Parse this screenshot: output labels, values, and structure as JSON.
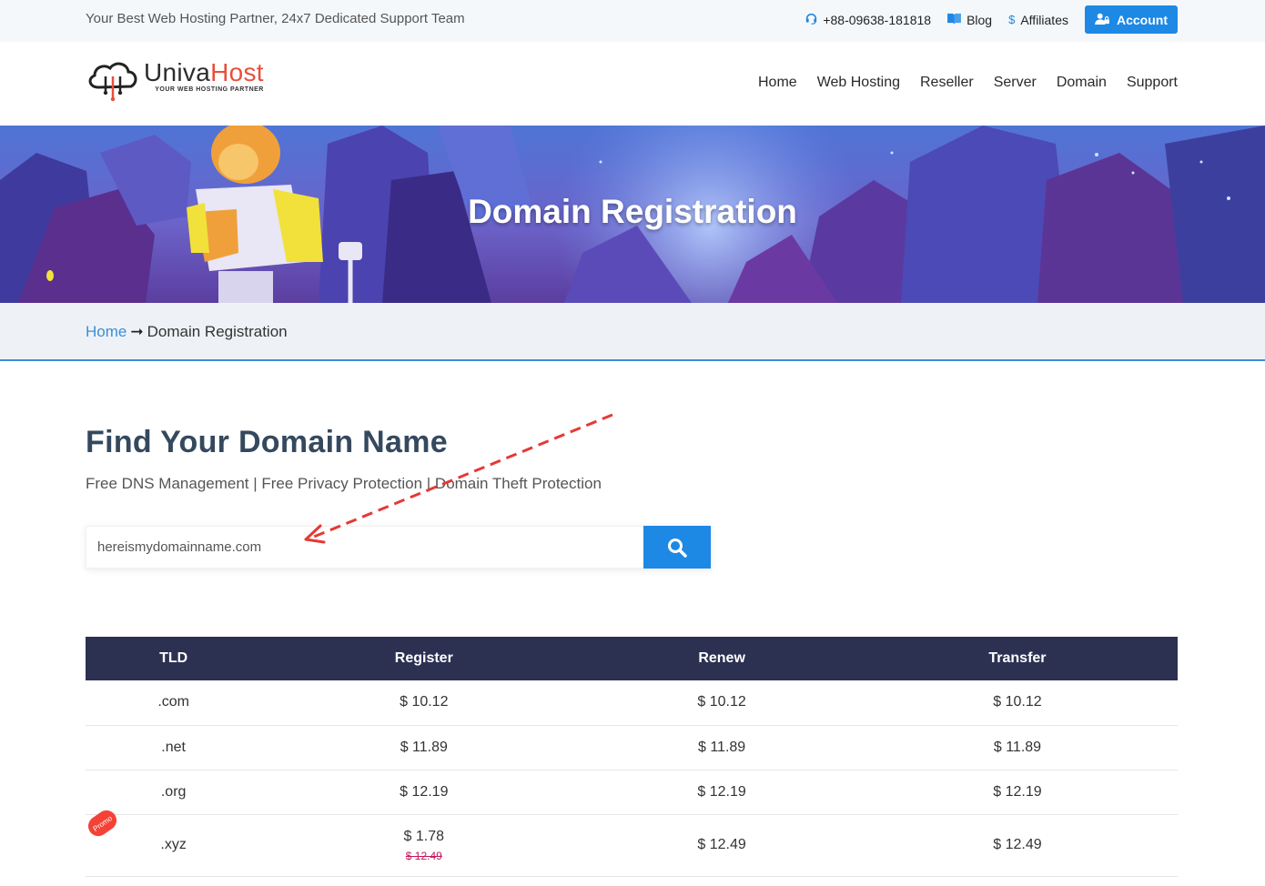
{
  "topbar": {
    "tagline": "Your Best Web Hosting Partner, 24x7 Dedicated Support Team",
    "phone": "+88-09638-181818",
    "blog": "Blog",
    "affiliates": "Affiliates",
    "account": "Account"
  },
  "logo": {
    "name_part1": "Univa",
    "name_part2": "Host",
    "tagline": "YOUR WEB HOSTING PARTNER"
  },
  "nav": [
    "Home",
    "Web Hosting",
    "Reseller",
    "Server",
    "Domain",
    "Support"
  ],
  "hero": {
    "title": "Domain Registration"
  },
  "breadcrumb": {
    "home": "Home",
    "arrow": "➞",
    "current": "Domain Registration"
  },
  "main": {
    "heading": "Find Your Domain Name",
    "subtext": "Free DNS Management | Free Privacy Protection | Domain Theft Protection",
    "search_value": "hereismydomainname.com"
  },
  "table": {
    "headers": [
      "TLD",
      "Register",
      "Renew",
      "Transfer"
    ],
    "rows": [
      {
        "tld": ".com",
        "register": "$ 10.12",
        "renew": "$ 10.12",
        "transfer": "$ 10.12"
      },
      {
        "tld": ".net",
        "register": "$ 11.89",
        "renew": "$ 11.89",
        "transfer": "$ 11.89"
      },
      {
        "tld": ".org",
        "register": "$ 12.19",
        "renew": "$ 12.19",
        "transfer": "$ 12.19"
      },
      {
        "tld": ".xyz",
        "register": "$ 1.78",
        "register_old": "$ 12.49",
        "renew": "$ 12.49",
        "transfer": "$ 12.49",
        "badge": "Promo"
      }
    ]
  },
  "colors": {
    "accent": "#1e88e5",
    "table_header": "#2c3152",
    "promo": "#f44336",
    "annotation": "#e53935"
  }
}
